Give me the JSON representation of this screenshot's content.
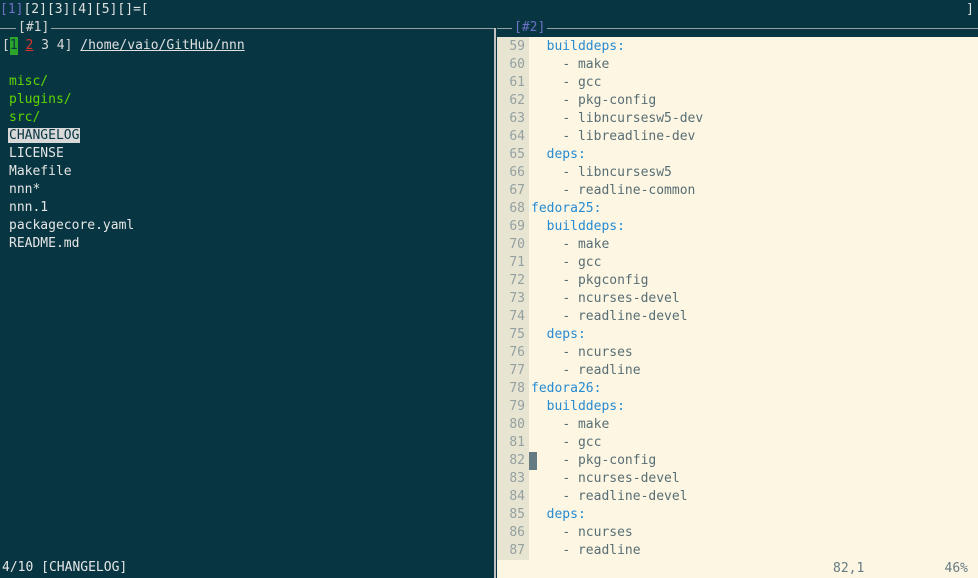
{
  "tabbar": {
    "tabs": [
      "[1]",
      "[2]",
      "[3]",
      "[4]",
      "[5]",
      "[]=["
    ],
    "active_index": 0,
    "right_marker": "]"
  },
  "left_pane": {
    "title": "[#1]",
    "contexts": {
      "open": "[",
      "items": [
        "1",
        "2",
        "3",
        "4"
      ],
      "close": "]"
    },
    "path": "/home/vaio/GitHub/nnn",
    "entries": [
      {
        "name": "misc/",
        "type": "dir"
      },
      {
        "name": "plugins/",
        "type": "dir"
      },
      {
        "name": "src/",
        "type": "dir"
      },
      {
        "name": "CHANGELOG",
        "type": "file",
        "selected": true
      },
      {
        "name": "LICENSE",
        "type": "file"
      },
      {
        "name": "Makefile",
        "type": "file"
      },
      {
        "name": "nnn*",
        "type": "file"
      },
      {
        "name": "nnn.1",
        "type": "file"
      },
      {
        "name": "packagecore.yaml",
        "type": "file"
      },
      {
        "name": "README.md",
        "type": "file"
      }
    ],
    "status": "4/10 [CHANGELOG]"
  },
  "right_pane": {
    "title": "[#2]",
    "lines": [
      {
        "n": "59",
        "indent": "  ",
        "text": "builddeps:",
        "key": true
      },
      {
        "n": "60",
        "indent": "    ",
        "text": "- make"
      },
      {
        "n": "61",
        "indent": "    ",
        "text": "- gcc"
      },
      {
        "n": "62",
        "indent": "    ",
        "text": "- pkg-config"
      },
      {
        "n": "63",
        "indent": "    ",
        "text": "- libncursesw5-dev"
      },
      {
        "n": "64",
        "indent": "    ",
        "text": "- libreadline-dev"
      },
      {
        "n": "65",
        "indent": "  ",
        "text": "deps:",
        "key": true
      },
      {
        "n": "66",
        "indent": "    ",
        "text": "- libncursesw5"
      },
      {
        "n": "67",
        "indent": "    ",
        "text": "- readline-common"
      },
      {
        "n": "68",
        "indent": "",
        "text": "fedora25:",
        "key": true
      },
      {
        "n": "69",
        "indent": "  ",
        "text": "builddeps:",
        "key": true
      },
      {
        "n": "70",
        "indent": "    ",
        "text": "- make"
      },
      {
        "n": "71",
        "indent": "    ",
        "text": "- gcc"
      },
      {
        "n": "72",
        "indent": "    ",
        "text": "- pkgconfig"
      },
      {
        "n": "73",
        "indent": "    ",
        "text": "- ncurses-devel"
      },
      {
        "n": "74",
        "indent": "    ",
        "text": "- readline-devel"
      },
      {
        "n": "75",
        "indent": "  ",
        "text": "deps:",
        "key": true
      },
      {
        "n": "76",
        "indent": "    ",
        "text": "- ncurses"
      },
      {
        "n": "77",
        "indent": "    ",
        "text": "- readline"
      },
      {
        "n": "78",
        "indent": "",
        "text": "fedora26:",
        "key": true
      },
      {
        "n": "79",
        "indent": "  ",
        "text": "builddeps:",
        "key": true
      },
      {
        "n": "80",
        "indent": "    ",
        "text": "- make"
      },
      {
        "n": "81",
        "indent": "    ",
        "text": "- gcc"
      },
      {
        "n": "82",
        "indent": "    ",
        "text": "- pkg-config",
        "cursor": true
      },
      {
        "n": "83",
        "indent": "    ",
        "text": "- ncurses-devel"
      },
      {
        "n": "84",
        "indent": "    ",
        "text": "- readline-devel"
      },
      {
        "n": "85",
        "indent": "  ",
        "text": "deps:",
        "key": true
      },
      {
        "n": "86",
        "indent": "    ",
        "text": "- ncurses"
      },
      {
        "n": "87",
        "indent": "    ",
        "text": "- readline"
      }
    ],
    "position": "82,1",
    "percent": "46%"
  }
}
